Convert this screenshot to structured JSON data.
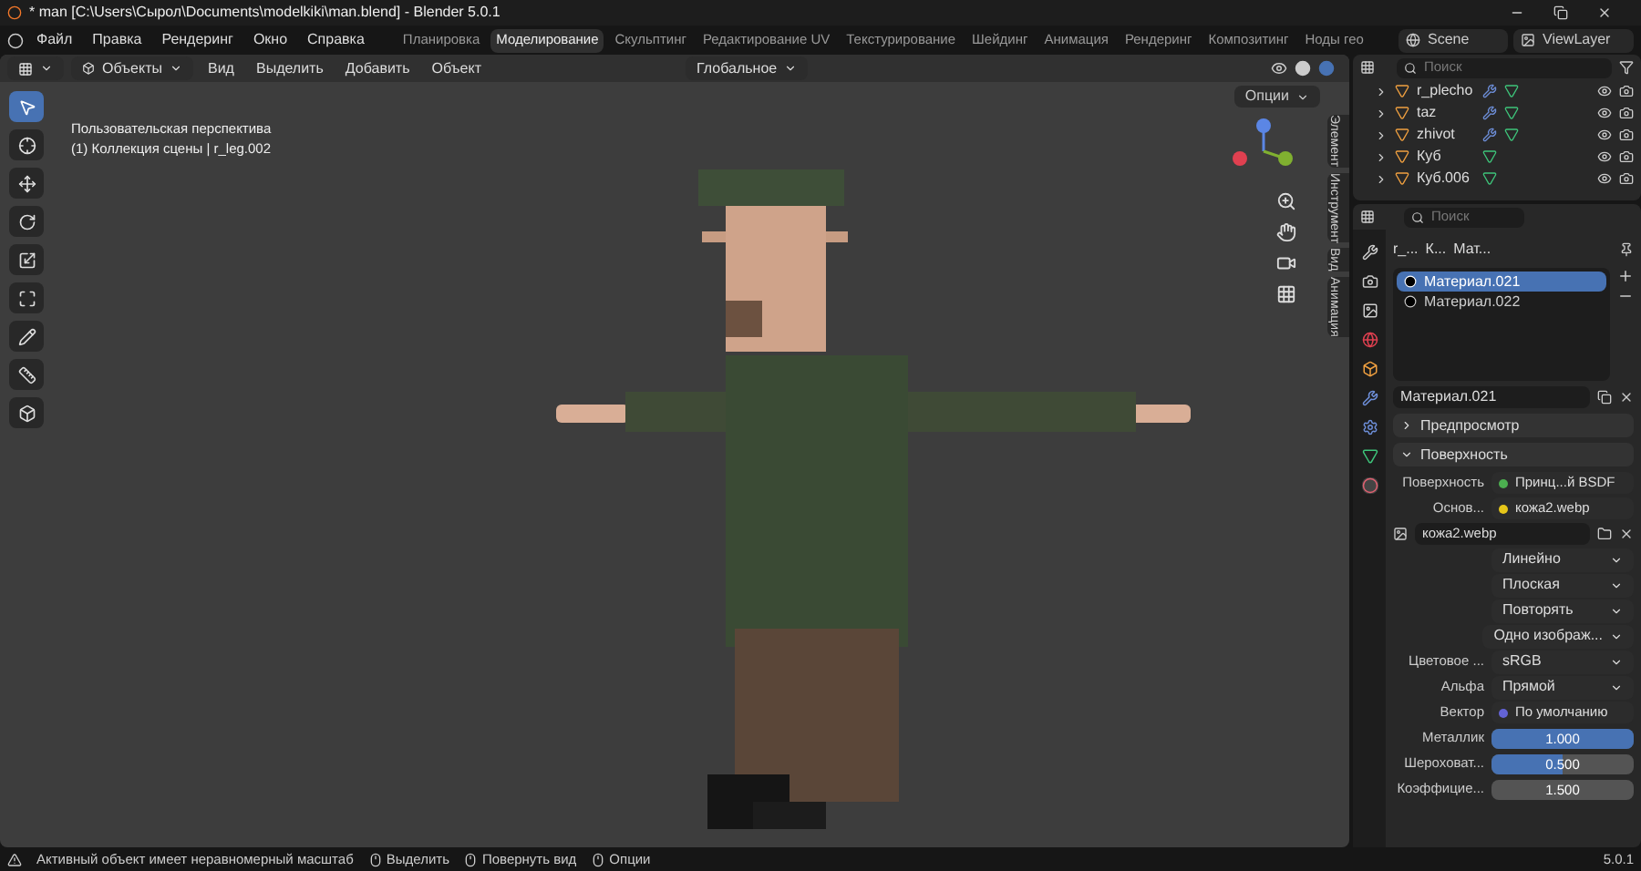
{
  "window": {
    "title": "* man [C:\\Users\\Сырол\\Documents\\modelkiki\\man.blend] - Blender 5.0.1"
  },
  "menu": [
    "Файл",
    "Правка",
    "Рендеринг",
    "Окно",
    "Справка"
  ],
  "workspaces": [
    {
      "label": "Планировка",
      "selected": false
    },
    {
      "label": "Моделирование",
      "selected": true
    },
    {
      "label": "Скульптинг",
      "selected": false
    },
    {
      "label": "Редактирование UV",
      "selected": false
    },
    {
      "label": "Текстурирование",
      "selected": false
    },
    {
      "label": "Шейдинг",
      "selected": false
    },
    {
      "label": "Анимация",
      "selected": false
    },
    {
      "label": "Рендеринг",
      "selected": false
    },
    {
      "label": "Композитинг",
      "selected": false
    },
    {
      "label": "Ноды гео",
      "selected": false
    }
  ],
  "scene": "Scene",
  "view_layer": "ViewLayer",
  "viewport": {
    "mode": "Объекты",
    "menus": [
      "Вид",
      "Выделить",
      "Добавить",
      "Объект"
    ],
    "orientation": "Глобальное",
    "options": "Опции",
    "overlay": [
      "Пользовательская перспектива",
      "(1) Коллекция сцены | r_leg.002"
    ],
    "tools": [
      {
        "kind": "select",
        "selected": true
      },
      {
        "kind": "cursor",
        "selected": false
      },
      {
        "kind": "move",
        "selected": false
      },
      {
        "kind": "rotate",
        "selected": false
      },
      {
        "kind": "scale",
        "selected": false
      },
      {
        "kind": "transform",
        "selected": false
      },
      {
        "kind": "annotate",
        "selected": false
      },
      {
        "kind": "measure",
        "selected": false
      },
      {
        "kind": "add-cube",
        "selected": false
      }
    ],
    "side_tabs": [
      "Элемент",
      "Инструмент",
      "Вид",
      "Анимация"
    ]
  },
  "outliner": {
    "search": {
      "placeholder": "Поиск"
    },
    "items": [
      {
        "name": "r_plecho",
        "modifiers": true
      },
      {
        "name": "taz",
        "modifiers": true
      },
      {
        "name": "zhivot",
        "modifiers": true
      },
      {
        "name": "Куб",
        "modifiers": false
      },
      {
        "name": "Куб.006",
        "modifiers": false
      }
    ]
  },
  "properties": {
    "search": {
      "placeholder": "Поиск"
    },
    "breadcrumbs": [
      "r_...",
      "К...",
      "Мат..."
    ],
    "materials": [
      {
        "name": "Материал.021",
        "selected": true
      },
      {
        "name": "Материал.022",
        "selected": false
      }
    ],
    "material_name": "Материал.021",
    "panels": [
      {
        "title": "Предпросмотр",
        "expanded": false
      },
      {
        "title": "Поверхность",
        "expanded": true
      }
    ],
    "rows": [
      {
        "kind": "link",
        "label": "Поверхность",
        "value": "Принц...й BSDF",
        "color": "#4caf50"
      },
      {
        "kind": "link",
        "label": "Основ...",
        "value": "кожа2.webp",
        "color": "#e6c619"
      },
      {
        "kind": "image",
        "value": "кожа2.webp"
      },
      {
        "kind": "dropdown",
        "value": "Линейно"
      },
      {
        "kind": "dropdown",
        "value": "Плоская"
      },
      {
        "kind": "dropdown",
        "value": "Повторять"
      },
      {
        "kind": "dropdown",
        "value": "Одно изображ..."
      },
      {
        "kind": "dropdown",
        "label": "Цветовое ...",
        "value": "sRGB"
      },
      {
        "kind": "dropdown",
        "label": "Альфа",
        "value": "Прямой"
      },
      {
        "kind": "link",
        "label": "Вектор",
        "value": "По умолчанию",
        "color": "#6363d6"
      },
      {
        "kind": "slider",
        "label": "Металлик",
        "value": "1.000",
        "level": 1
      },
      {
        "kind": "slider",
        "label": "Шероховат...",
        "value": "0.500",
        "level": 0.5
      },
      {
        "kind": "slider",
        "label": "Коэффицие...",
        "value": "1.500"
      }
    ]
  },
  "status_bar": {
    "message": "Активный объект имеет неравномерный масштаб",
    "hints": [
      "Выделить",
      "Повернуть вид",
      "Опции"
    ],
    "version": "5.0.1"
  }
}
